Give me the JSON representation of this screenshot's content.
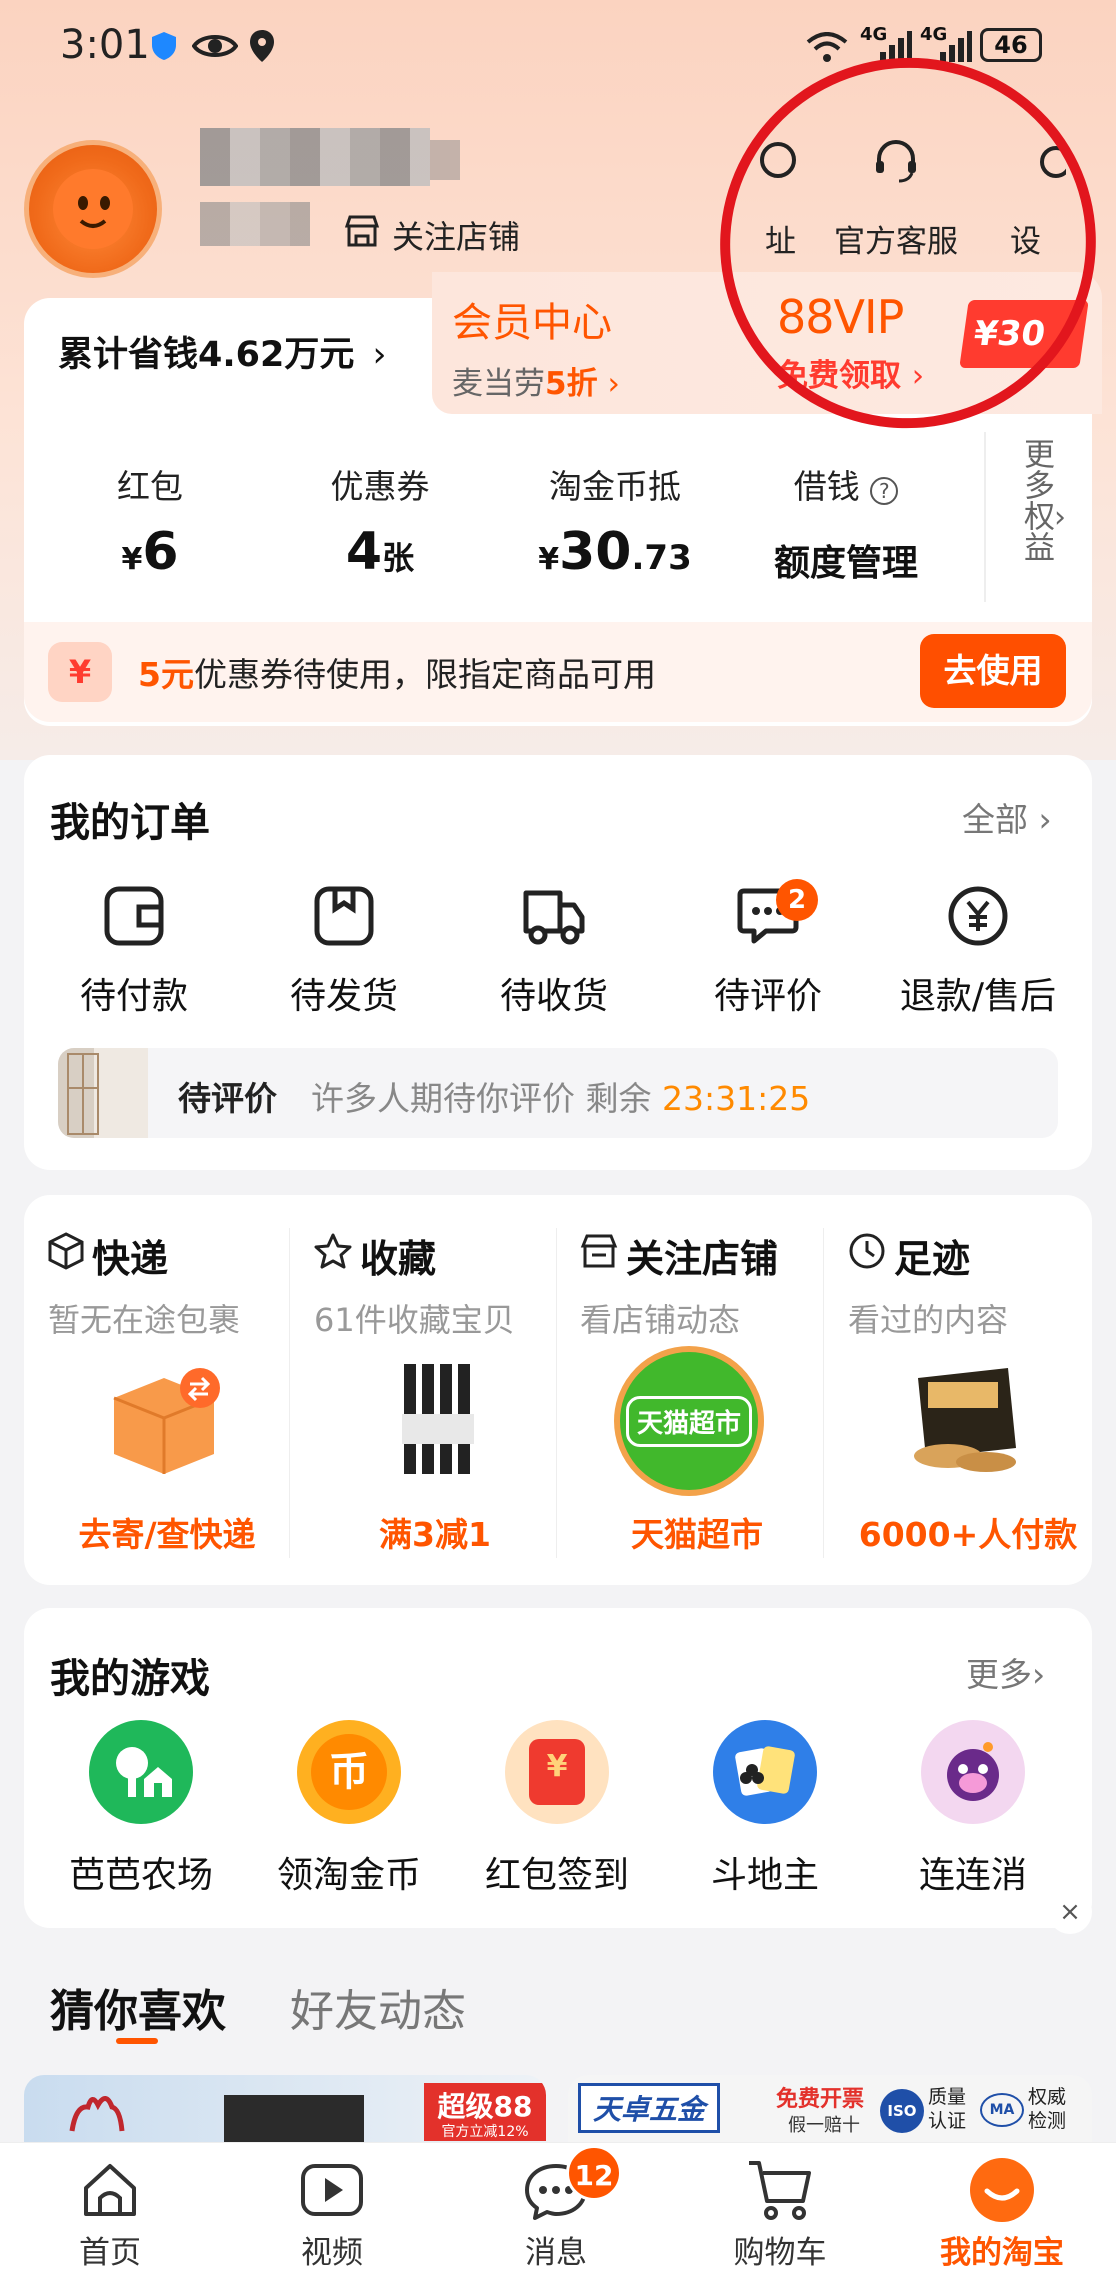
{
  "status_bar": {
    "time": "3:01",
    "net1": "4G",
    "net2": "4G",
    "battery": "46"
  },
  "profile": {
    "follow_label": "关注店铺"
  },
  "header_actions": [
    {
      "label": "址",
      "icon": "location-icon"
    },
    {
      "label": "官方客服",
      "icon": "headset-icon"
    },
    {
      "label": "设",
      "icon": "settings-icon"
    }
  ],
  "savings": {
    "text": "累计省钱4.62万元",
    "chevron": "›"
  },
  "member": {
    "title": "会员中心",
    "sub_prefix": "麦当劳",
    "sub_highlight": "5折",
    "chevron": "›"
  },
  "vip": {
    "title": "88VIP",
    "sub": "免费领取",
    "chevron": "›",
    "tag": "¥30"
  },
  "assets": [
    {
      "label": "红包",
      "currency": "¥",
      "value": "6",
      "suffix": ""
    },
    {
      "label": "优惠券",
      "currency": "",
      "value": "4",
      "suffix": "张"
    },
    {
      "label": "淘金币抵",
      "currency": "¥",
      "value": "30",
      "suffix": ".73"
    },
    {
      "label": "借钱",
      "currency": "",
      "value": "额度管理",
      "suffix": ""
    }
  ],
  "more_benefits": "更多权益",
  "coupon_bar": {
    "highlight": "5元",
    "text": "优惠券待使用，限指定商品可用",
    "button": "去使用",
    "icon_glyph": "¥"
  },
  "orders": {
    "title": "我的订单",
    "more": "全部",
    "items": [
      {
        "label": "待付款",
        "icon": "wallet-icon"
      },
      {
        "label": "待发货",
        "icon": "box-icon"
      },
      {
        "label": "待收货",
        "icon": "truck-icon"
      },
      {
        "label": "待评价",
        "icon": "comment-icon",
        "badge": "2"
      },
      {
        "label": "退款/售后",
        "icon": "refund-icon"
      }
    ],
    "pending": {
      "title": "待评价",
      "text": "许多人期待你评价 剩余",
      "countdown": "23:31:25"
    }
  },
  "features": [
    {
      "title": "快递",
      "subtitle": "暂无在途包裹",
      "promo": "去寄/查快递",
      "icon": "package-icon"
    },
    {
      "title": "收藏",
      "subtitle": "61件收藏宝贝",
      "promo": "满3减1",
      "icon": "star-icon"
    },
    {
      "title": "关注店铺",
      "subtitle": "看店铺动态",
      "promo": "天猫超市",
      "icon": "store-icon",
      "logo_text": "天猫超市"
    },
    {
      "title": "足迹",
      "subtitle": "看过的内容",
      "promo": "6000+人付款",
      "icon": "clock-icon"
    }
  ],
  "games": {
    "title": "我的游戏",
    "more": "更多",
    "items": [
      {
        "label": "芭芭农场",
        "color": "#1fb85a",
        "icon": "farm-icon"
      },
      {
        "label": "领淘金币",
        "color": "#ffb020",
        "icon": "coin-icon",
        "glyph": "币"
      },
      {
        "label": "红包签到",
        "color": "#ffd9a8",
        "icon": "redpacket-icon",
        "glyph": "¥"
      },
      {
        "label": "斗地主",
        "color": "#2f7fe8",
        "icon": "cards-icon"
      },
      {
        "label": "连连消",
        "color": "#f3d7f0",
        "icon": "match-game-icon"
      }
    ]
  },
  "feed_tabs": [
    {
      "label": "猜你喜欢",
      "active": true
    },
    {
      "label": "好友动态",
      "active": false
    }
  ],
  "feed_preview": {
    "left_tag": "超级88",
    "left_sub": "官方立减12%",
    "right_brand": "天卓五金",
    "right_badge": "免费开票",
    "right_badge_sub": "假一赔十",
    "right_q1": "质量认证",
    "right_q2": "权威检测",
    "iso": "ISO",
    "ma": "MA"
  },
  "tab_bar": [
    {
      "label": "首页",
      "icon": "home-icon"
    },
    {
      "label": "视频",
      "icon": "video-icon"
    },
    {
      "label": "消息",
      "icon": "message-icon",
      "badge": "12"
    },
    {
      "label": "购物车",
      "icon": "cart-icon"
    },
    {
      "label": "我的淘宝",
      "icon": "my-taobao-icon",
      "active": true
    }
  ],
  "colors": {
    "accent": "#ff5500",
    "red_annotation": "#e2161d",
    "vip_red": "#ff3b2f"
  }
}
